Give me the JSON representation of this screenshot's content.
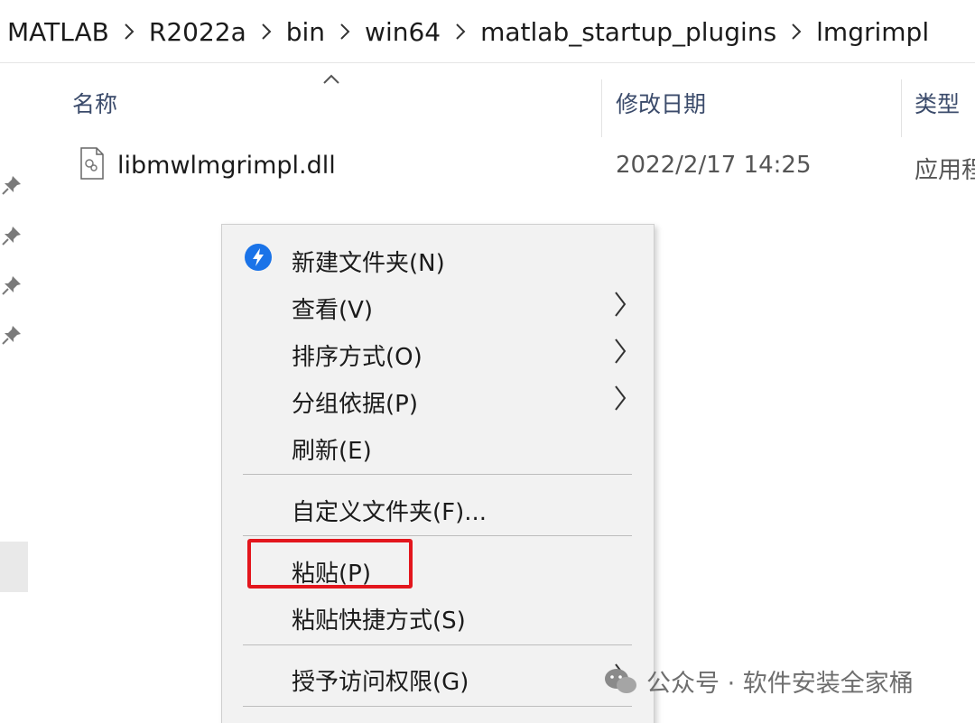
{
  "breadcrumb": {
    "items": [
      "MATLAB",
      "R2022a",
      "bin",
      "win64",
      "matlab_startup_plugins",
      "lmgrimpl"
    ]
  },
  "columns": {
    "name": "名称",
    "date": "修改日期",
    "type": "类型"
  },
  "files": [
    {
      "name": "libmwlmgrimpl.dll",
      "date": "2022/2/17 14:25",
      "type": "应用程"
    }
  ],
  "context_menu": {
    "items": [
      {
        "label": "新建文件夹(N)",
        "icon": "shield-icon",
        "submenu": false
      },
      {
        "label": "查看(V)",
        "submenu": true
      },
      {
        "label": "排序方式(O)",
        "submenu": true
      },
      {
        "label": "分组依据(P)",
        "submenu": true
      },
      {
        "label": "刷新(E)",
        "submenu": false
      },
      {
        "label": "自定义文件夹(F)...",
        "submenu": false
      },
      {
        "label": "粘贴(P)",
        "submenu": false,
        "highlighted": true
      },
      {
        "label": "粘贴快捷方式(S)",
        "submenu": false
      },
      {
        "label": "授予访问权限(G)",
        "submenu": true
      }
    ]
  },
  "watermark": {
    "text": "公众号 · 软件安装全家桶"
  },
  "colors": {
    "highlight": "#e3161d",
    "accent": "#1a73e8",
    "menu_bg": "#f2f2f2"
  }
}
